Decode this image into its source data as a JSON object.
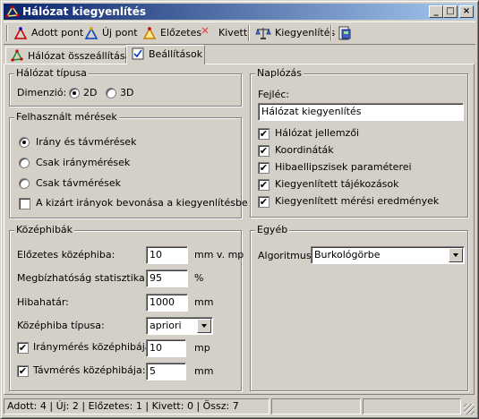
{
  "window": {
    "title": "Hálózat kiegyenlítés"
  },
  "toolbar": {
    "adott_pont": "Adott pont",
    "uj_pont": "Új pont",
    "elozetes": "Előzetes",
    "kivett": "Kivett",
    "kiegyenlites": "Kiegyenlítés"
  },
  "tabs": [
    {
      "label": "Hálózat összeállítása"
    },
    {
      "label": "Beállítások"
    }
  ],
  "halozat_tipusa": {
    "title": "Hálózat típusa",
    "dimenzio_label": "Dimenzió:",
    "options": [
      "2D",
      "3D"
    ],
    "selected": "2D"
  },
  "meresek": {
    "title": "Felhasznált mérések",
    "options": [
      "Irány és távmérések",
      "Csak iránymérések",
      "Csak távmérések"
    ],
    "selected": "Irány és távmérések",
    "checkbox_label": "A kizárt irányok bevonása a kiegyenlítésbe",
    "checkbox_checked": false
  },
  "kozephibak": {
    "title": "Középhibák",
    "elozetes_label": "Előzetes középhiba:",
    "elozetes_value": "10",
    "elozetes_unit": "mm v. mp",
    "megbizhatosag_label": "Megbízhatóság statisztika:",
    "megbizhatosag_value": "95",
    "megbizhatosag_unit": "%",
    "hibahatar_label": "Hibahatár:",
    "hibahatar_value": "1000",
    "hibahatar_unit": "mm",
    "tipus_label": "Középhiba típusa:",
    "tipus_value": "apriori",
    "iranymeres_label": "Iránymérés középhibája:",
    "iranymeres_value": "10",
    "iranymeres_unit": "mp",
    "tavmeres_label": "Távmérés középhibája:",
    "tavmeres_value": "5",
    "tavmeres_unit": "mm"
  },
  "naplozas": {
    "title": "Naplózás",
    "fejlec_label": "Fejléc:",
    "fejlec_value": "Hálózat kiegyenlítés",
    "items": [
      "Hálózat jellemzői",
      "Koordináták",
      "Hibaellipszisek paraméterei",
      "Kiegyenlített tájékozások",
      "Kiegyenlített mérési eredmények"
    ]
  },
  "egyeb": {
    "title": "Egyéb",
    "algoritmus_label": "Algoritmus:",
    "algoritmus_value": "Burkológörbe"
  },
  "status": {
    "text": "Adott: 4 | Új: 2 | Előzetes: 1 | Kivett: 0 | Össz: 7"
  },
  "icons": [
    "network-icon",
    "minimize-icon",
    "maximize-icon",
    "close-icon",
    "triangle-point-icon",
    "cross-icon",
    "balance-icon",
    "export-icon",
    "network-tab-icon",
    "settings-tab-icon"
  ]
}
